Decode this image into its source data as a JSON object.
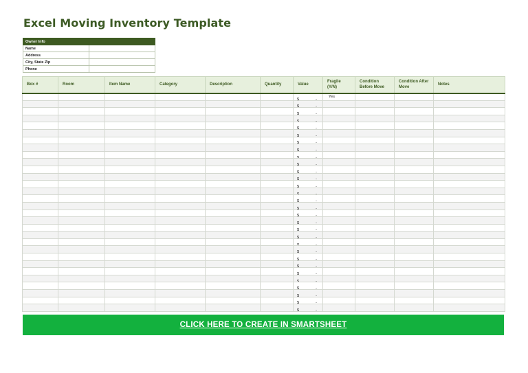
{
  "title": "Excel Moving Inventory Template",
  "owner": {
    "header": "Owner Info",
    "fields": [
      "Name",
      "Address",
      "City, State Zip",
      "Phone"
    ]
  },
  "inventory": {
    "columns": [
      "Box #",
      "Room",
      "Item Name",
      "Category",
      "Description",
      "Quantity",
      "Value",
      "Fragile (Y/N)",
      "Condition Before Move",
      "Condition After Move",
      "Notes"
    ],
    "currency_symbol": "$",
    "empty_value": "-",
    "first_row_fragile": "Yes",
    "row_count": 30
  },
  "cta": {
    "label": "CLICK HERE TO CREATE IN SMARTSHEET"
  },
  "colors": {
    "title": "#3c5a24",
    "header_dark": "#3d5a21",
    "header_light": "#e7f0dd",
    "cta": "#13b13e"
  }
}
